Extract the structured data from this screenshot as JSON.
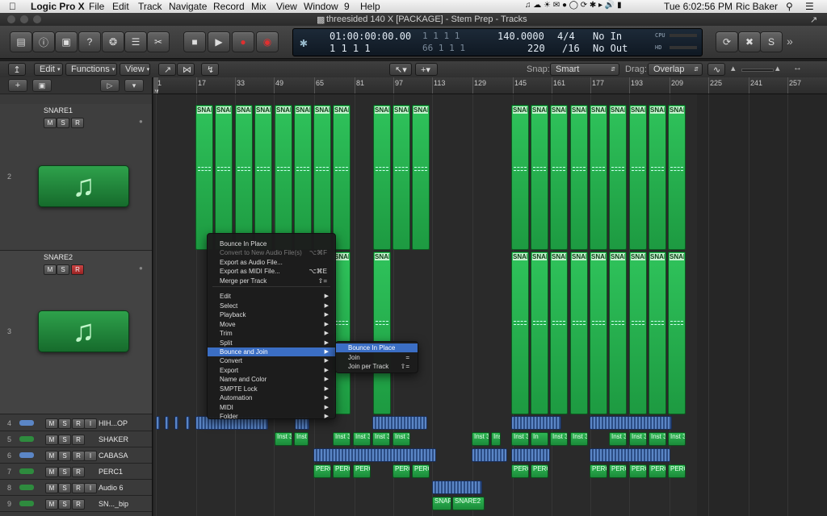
{
  "menubar": {
    "app": "Logic Pro X",
    "items": [
      "File",
      "Edit",
      "Track",
      "Navigate",
      "Record",
      "Mix",
      "View",
      "Window",
      "9",
      "Help"
    ],
    "clock": "Tue 6:02:56 PM",
    "user": "Ric Baker"
  },
  "window": {
    "title": "threesided 140 X [PACKAGE] - Stem Prep - Tracks"
  },
  "lcd": {
    "smpte": "01:00:00:00.00",
    "smpte2": "1 1 1 1",
    "bars_top": "1 1 1 1",
    "bars_bottom": "66 1 1 1",
    "tempo": "140.0000",
    "tempo_bottom": "220",
    "signature": "4/4",
    "division": "/16",
    "in": "No In",
    "out": "No Out",
    "cpu_label": "CPU",
    "hd_label": "HD"
  },
  "editbar": {
    "edit": "Edit",
    "functions": "Functions",
    "view": "View",
    "snap_label": "Snap:",
    "snap_value": "Smart",
    "drag_label": "Drag:",
    "drag_value": "Overlap"
  },
  "ruler": {
    "ticks": [
      "1",
      "17",
      "33",
      "49",
      "65",
      "81",
      "97",
      "113",
      "129",
      "145",
      "161",
      "177",
      "193",
      "209",
      "225",
      "241",
      "257"
    ]
  },
  "tracks": [
    {
      "number": "2",
      "name": "SNARE1"
    },
    {
      "number": "3",
      "name": "SNARE2"
    },
    {
      "number": "4",
      "name": "HIH...OP"
    },
    {
      "number": "5",
      "name": "SHAKER"
    },
    {
      "number": "6",
      "name": "CABASA"
    },
    {
      "number": "7",
      "name": "PERC1"
    },
    {
      "number": "8",
      "name": "Audio 6"
    },
    {
      "number": "9",
      "name": "SN..._bip"
    }
  ],
  "track_buttons": {
    "m": "M",
    "s": "S",
    "r": "R",
    "i": "I"
  },
  "regions": {
    "snap": "SNAP",
    "snare": "SNAR",
    "inst": "Inst 3",
    "inst_short": "In",
    "perc": "PERC",
    "snare2": "SNARE2"
  },
  "context_menu": {
    "items": [
      {
        "label": "Bounce In Place",
        "shortcut": "",
        "enabled": true
      },
      {
        "label": "Convert to New Audio File(s)",
        "shortcut": "⌥⌘F",
        "enabled": false
      },
      {
        "label": "Export as Audio File...",
        "shortcut": "",
        "enabled": true
      },
      {
        "label": "Export as MIDI File...",
        "shortcut": "⌥⌘E",
        "enabled": true
      },
      {
        "label": "Merge per Track",
        "shortcut": "⇧=",
        "enabled": true
      },
      {
        "label": "Edit",
        "shortcut": "",
        "enabled": true
      },
      {
        "label": "Select",
        "shortcut": "",
        "enabled": true
      },
      {
        "label": "Playback",
        "shortcut": "",
        "enabled": true
      },
      {
        "label": "Move",
        "shortcut": "",
        "enabled": true
      },
      {
        "label": "Trim",
        "shortcut": "",
        "enabled": true
      },
      {
        "label": "Split",
        "shortcut": "",
        "enabled": true
      },
      {
        "label": "Bounce and Join",
        "shortcut": "",
        "enabled": true
      },
      {
        "label": "Convert",
        "shortcut": "",
        "enabled": true
      },
      {
        "label": "Export",
        "shortcut": "",
        "enabled": true
      },
      {
        "label": "Name and Color",
        "shortcut": "",
        "enabled": true
      },
      {
        "label": "SMPTE Lock",
        "shortcut": "",
        "enabled": true
      },
      {
        "label": "Automation",
        "shortcut": "",
        "enabled": true
      },
      {
        "label": "MIDI",
        "shortcut": "",
        "enabled": true
      },
      {
        "label": "Folder",
        "shortcut": "",
        "enabled": true
      }
    ],
    "submenu": [
      {
        "label": "Bounce In Place",
        "shortcut": ""
      },
      {
        "label": "Join",
        "shortcut": "="
      },
      {
        "label": "Join per Track",
        "shortcut": "⇧="
      }
    ]
  },
  "colors": {
    "region_green": "#1d9a41",
    "menu_highlight": "#3b6ec4",
    "midi_blue": "#5b86c6"
  }
}
